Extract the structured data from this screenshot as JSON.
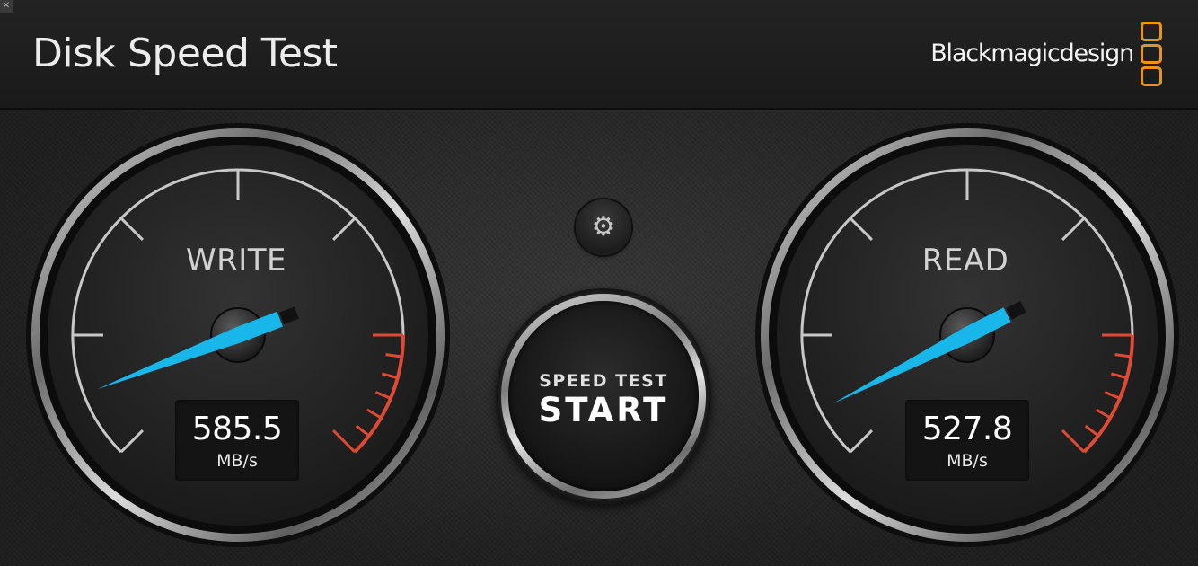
{
  "window": {
    "close_glyph": "✕"
  },
  "header": {
    "title": "Disk Speed Test",
    "brand": "Blackmagicdesign",
    "brand_color": "#e8951f"
  },
  "gauges": {
    "write": {
      "label": "WRITE",
      "value": "585.5",
      "unit": "MB/s"
    },
    "read": {
      "label": "READ",
      "value": "527.8",
      "unit": "MB/s"
    },
    "needle_color": "#19b6ea",
    "redline_color": "#e04a34"
  },
  "controls": {
    "settings_icon": "gear-icon",
    "settings_glyph": "⚙",
    "start_line1": "SPEED TEST",
    "start_line2": "START"
  }
}
